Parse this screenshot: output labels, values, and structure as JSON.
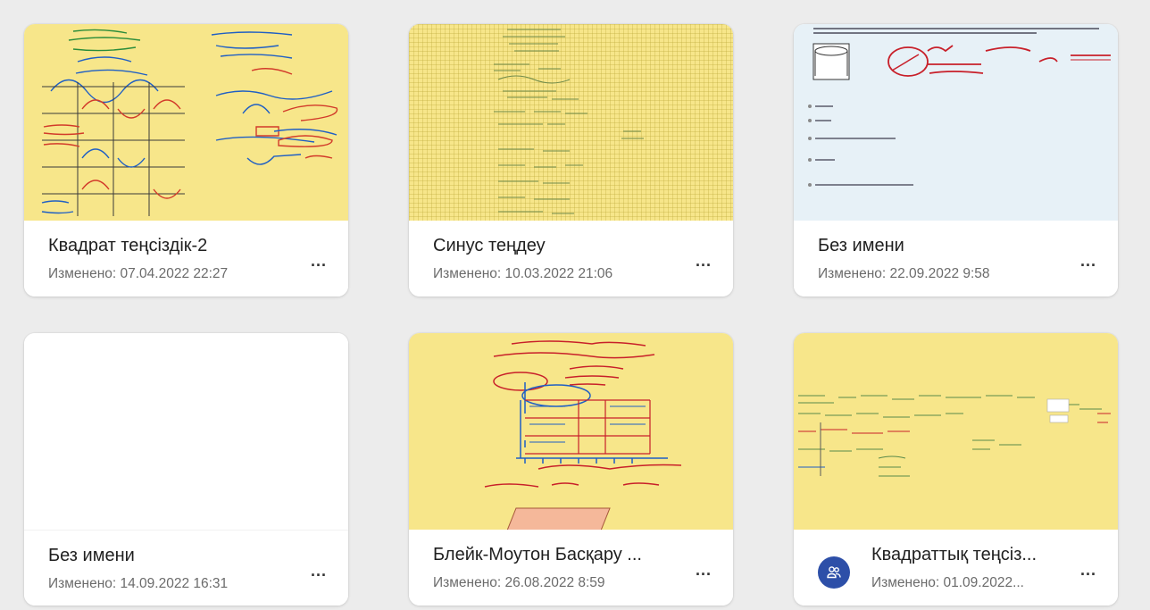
{
  "more_glyph": "...",
  "cards": [
    {
      "title": "Квадрат теңсіздік-2",
      "date": "Изменено: 07.04.2022 22:27"
    },
    {
      "title": "Синус теңдеу",
      "date": "Изменено: 10.03.2022 21:06"
    },
    {
      "title": "Без имени",
      "date": "Изменено: 22.09.2022 9:58"
    },
    {
      "title": "Без имени",
      "date": "Изменено: 14.09.2022 16:31"
    },
    {
      "title": "Блейк-Моутон Басқару ...",
      "date": "Изменено: 26.08.2022 8:59"
    },
    {
      "title": "Квадраттық теңсіз...",
      "date": "Изменено: 01.09.2022...",
      "shared": true,
      "shared_icon": "people-icon"
    }
  ],
  "colors": {
    "background": "#ececec",
    "thumb_yellow": "#f7e68a",
    "thumb_blue": "#e7f1f7",
    "avatar": "#2d4fa8"
  }
}
